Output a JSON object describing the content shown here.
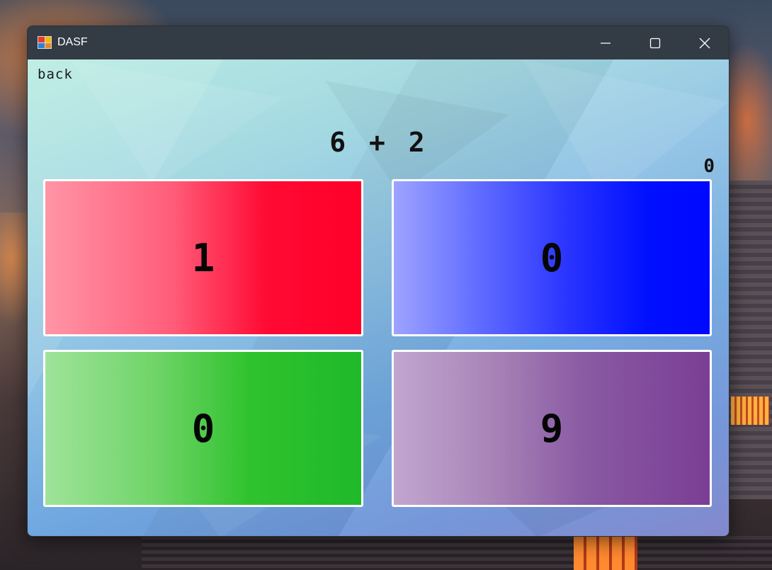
{
  "window": {
    "title": "DASF",
    "icon": "app-grid-icon",
    "controls": [
      "minimize-icon",
      "maximize-icon",
      "close-icon"
    ]
  },
  "game": {
    "back_label": "back",
    "question": "6 + 2",
    "score": "0",
    "answers": [
      {
        "label": "1",
        "color": "#ff002a"
      },
      {
        "label": "0",
        "color": "#0008ff"
      },
      {
        "label": "0",
        "color": "#1fb92a"
      },
      {
        "label": "9",
        "color": "#7a3e94"
      }
    ]
  }
}
